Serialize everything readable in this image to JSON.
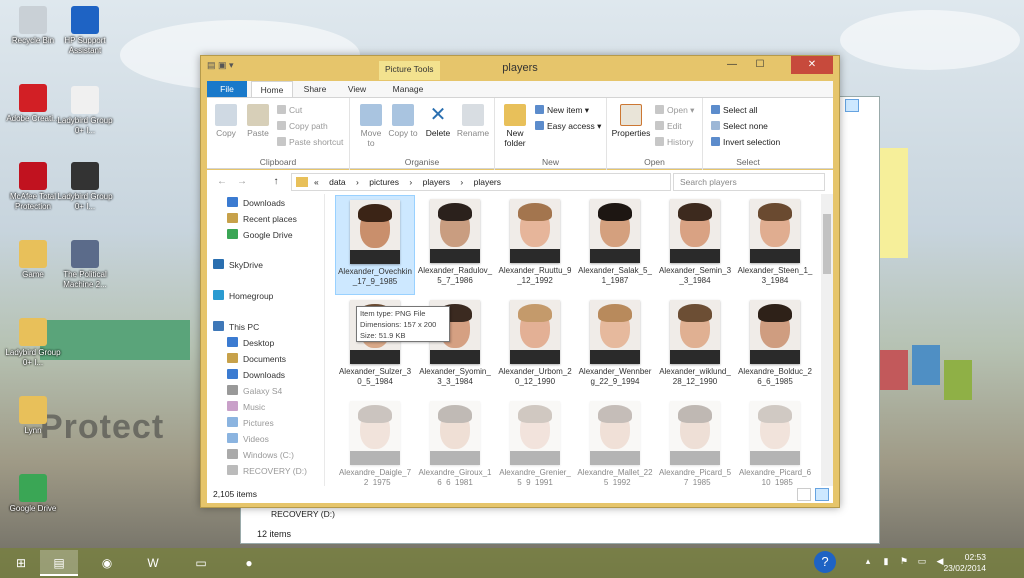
{
  "desktop": {
    "icons": [
      {
        "label": "Recycle Bin",
        "icon": "recycle-bin-icon",
        "color": "#c9d0d6"
      },
      {
        "label": "HP Support Assistant",
        "icon": "help-icon",
        "color": "#1e63c4"
      },
      {
        "label": "Adobe Creati...",
        "icon": "adobe-icon",
        "color": "#d21f25"
      },
      {
        "label": "Ladybird Group 0+ I...",
        "icon": "document-icon",
        "color": "#f0f0f0"
      },
      {
        "label": "McAfee Total Protection",
        "icon": "mcafee-icon",
        "color": "#c1121f"
      },
      {
        "label": "Ladybird Group 0+ I...",
        "icon": "car-seat-icon",
        "color": "#333333"
      },
      {
        "label": "Game",
        "icon": "folder-icon",
        "color": "#e8c05a"
      },
      {
        "label": "The Political Machine 2...",
        "icon": "game-icon",
        "color": "#5b6b8a"
      },
      {
        "label": "Ladybird Group 0+ I...",
        "icon": "folder-icon",
        "color": "#e8c05a"
      },
      {
        "label": "Lynn",
        "icon": "folder-icon",
        "color": "#e8c05a"
      },
      {
        "label": "Google Drive",
        "icon": "google-drive-icon",
        "color": "#3aa655"
      }
    ],
    "watermark": "Protect",
    "bg_window_status": "12 items",
    "bg_window_item": "RECOVERY (D:)"
  },
  "window": {
    "title": "players",
    "context_tab": "Picture Tools",
    "tabs": [
      "File",
      "Home",
      "Share",
      "View",
      "Manage"
    ],
    "controls": {
      "minimize": "—",
      "maximize": "☐",
      "close": "✕"
    }
  },
  "ribbon": {
    "clipboard": {
      "label": "Clipboard",
      "copy": "Copy",
      "paste": "Paste",
      "cut": "Cut",
      "copy_path": "Copy path",
      "paste_shortcut": "Paste shortcut"
    },
    "organise": {
      "label": "Organise",
      "move_to": "Move to",
      "copy_to": "Copy to",
      "delete": "Delete",
      "rename": "Rename"
    },
    "new": {
      "label": "New",
      "new_folder": "New folder",
      "new_item": "New item",
      "easy_access": "Easy access"
    },
    "open": {
      "label": "Open",
      "properties": "Properties",
      "open": "Open",
      "edit": "Edit",
      "history": "History"
    },
    "select": {
      "label": "Select",
      "select_all": "Select all",
      "select_none": "Select none",
      "invert": "Invert selection"
    }
  },
  "address": {
    "back": "←",
    "forward": "→",
    "up": "↑",
    "crumbs": [
      "«",
      "data",
      "›",
      "pictures",
      "›",
      "players",
      "›",
      "players"
    ],
    "search_placeholder": "Search players"
  },
  "nav": {
    "favorites": [
      "Downloads",
      "Recent places",
      "Google Drive"
    ],
    "skydrive": "SkyDrive",
    "homegroup": "Homegroup",
    "this_pc": "This PC",
    "pc_items": [
      "Desktop",
      "Documents",
      "Downloads",
      "Galaxy S4",
      "Music",
      "Pictures",
      "Videos",
      "Windows (C:)",
      "RECOVERY (D:)"
    ]
  },
  "files": [
    {
      "name": "Alexander_Ovechkin_17_9_1985",
      "skin": "#c98f6c",
      "hair": "#3b2416"
    },
    {
      "name": "Alexander_Radulov_5_7_1986",
      "skin": "#c99d80",
      "hair": "#2b211c"
    },
    {
      "name": "Alexander_Ruuttu_9_12_1992",
      "skin": "#e6b59a",
      "hair": "#a3754e"
    },
    {
      "name": "Alexander_Salak_5_1_1987",
      "skin": "#d4a07e",
      "hair": "#1d1612"
    },
    {
      "name": "Alexander_Semin_3_3_1984",
      "skin": "#d9a283",
      "hair": "#3d2a1e"
    },
    {
      "name": "Alexander_Steen_1_3_1984",
      "skin": "#e0ad90",
      "hair": "#6a4a30"
    },
    {
      "name": "Alexander_Sulzer_30_5_1984",
      "skin": "#d8a888",
      "hair": "#6b4c33"
    },
    {
      "name": "Alexander_Syomin_3_3_1984",
      "skin": "#d5a082",
      "hair": "#3b2a20"
    },
    {
      "name": "Alexander_Urbom_20_12_1990",
      "skin": "#e3b095",
      "hair": "#c49a6b"
    },
    {
      "name": "Alexander_Wennberg_22_9_1994",
      "skin": "#e6b99d",
      "hair": "#b88a5c"
    },
    {
      "name": "Alexander_wiklund_28_12_1990",
      "skin": "#e0b092",
      "hair": "#6c4e34"
    },
    {
      "name": "Alexandre_Bolduc_26_6_1985",
      "skin": "#cf9d80",
      "hair": "#2e2118"
    },
    {
      "name": "Alexandre_Daigle_7_2_1975",
      "skin": "#d9b19a",
      "hair": "#6d5a4a"
    },
    {
      "name": "Alexandre_Giroux_16_6_1981",
      "skin": "#d2a48a",
      "hair": "#4e3b2d"
    },
    {
      "name": "Alexandre_Grenier_5_9_1991",
      "skin": "#dcb29c",
      "hair": "#7a6350"
    },
    {
      "name": "Alexandre_Mallet_22_5_1992",
      "skin": "#d5a88e",
      "hair": "#5c4637"
    },
    {
      "name": "Alexandre_Picard_5_7_1985",
      "skin": "#d0a48b",
      "hair": "#4a3628"
    },
    {
      "name": "Alexandre_Picard_6_10_1985",
      "skin": "#dab19a",
      "hair": "#7c6755"
    }
  ],
  "tooltip": {
    "type": "Item type: PNG File",
    "dims": "Dimensions: 157 x 200",
    "size": "Size: 51.9 KB"
  },
  "status": {
    "count": "2,105 items"
  },
  "taskbar": {
    "start": "⊞",
    "items": [
      {
        "icon": "file-explorer-icon",
        "glyph": "▤"
      },
      {
        "icon": "chrome-icon",
        "glyph": "◉"
      },
      {
        "icon": "word-icon",
        "glyph": "W"
      },
      {
        "icon": "folder-icon",
        "glyph": "▭"
      },
      {
        "icon": "firefox-icon",
        "glyph": "●"
      }
    ],
    "time": "02:53",
    "date": "23/02/2014",
    "help": "?"
  }
}
